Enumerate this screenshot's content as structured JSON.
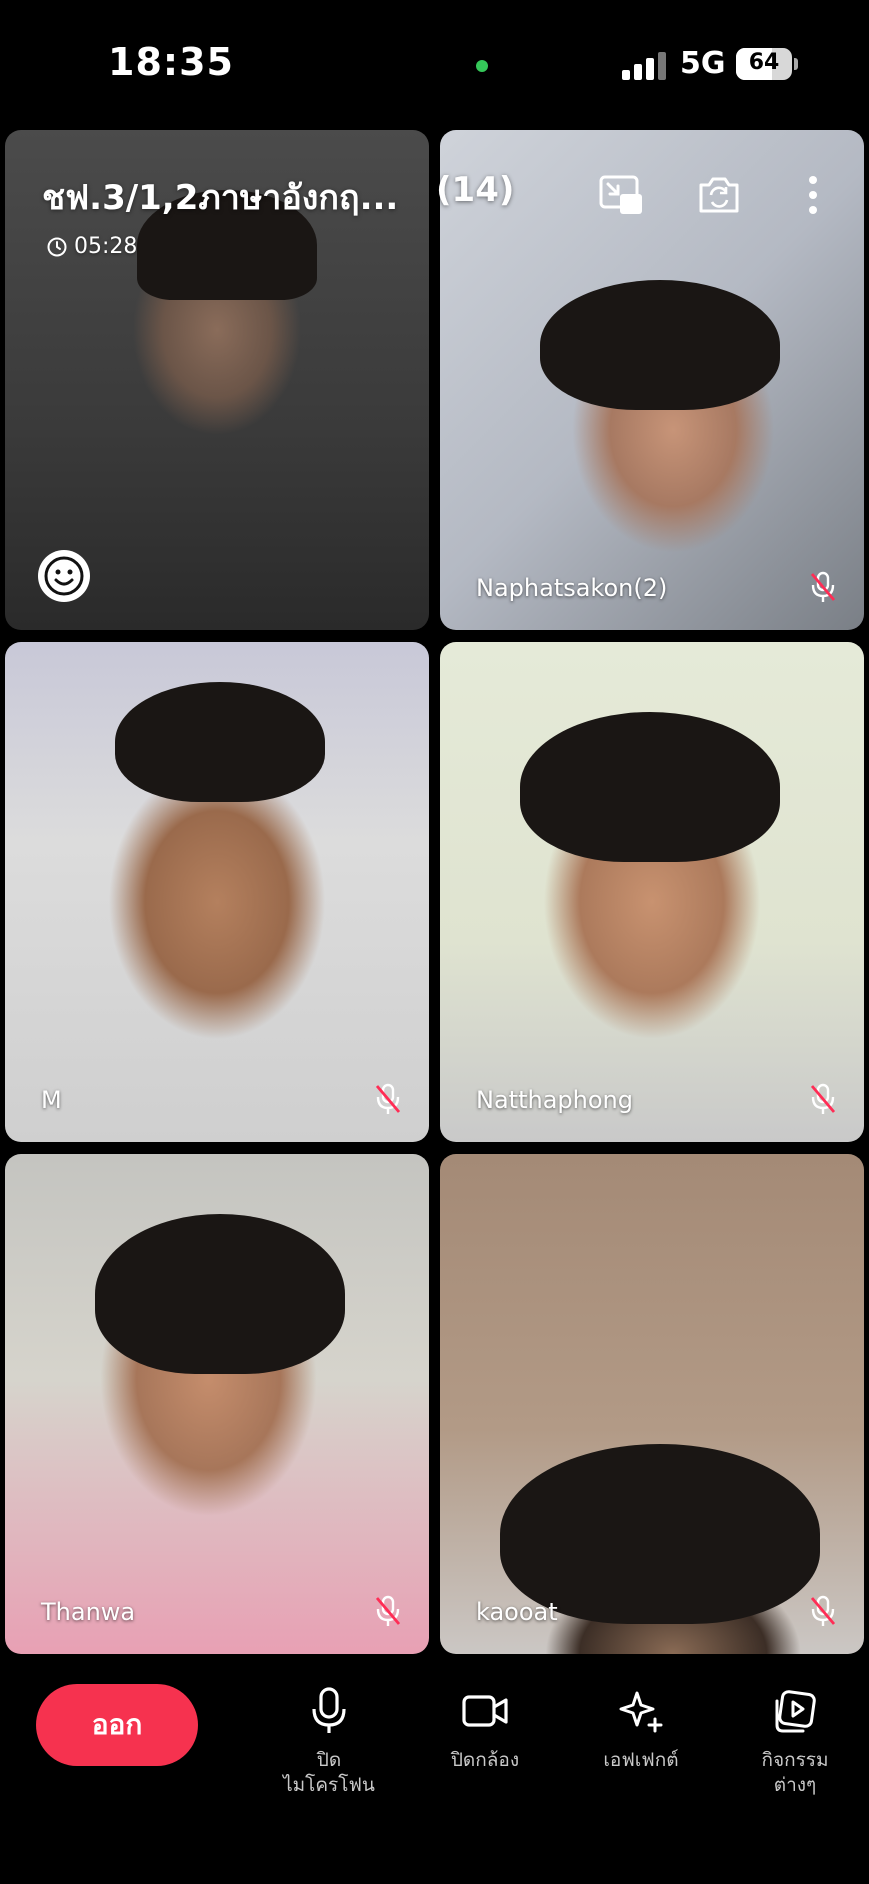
{
  "status_bar": {
    "time": "18:35",
    "network": "5G",
    "battery": "64",
    "battery_level": 0.64
  },
  "header": {
    "room_title": "ชฟ.3/1,2ภาษาอังกฤ...",
    "participant_count": "(14)",
    "elapsed": "05:28"
  },
  "participants": [
    {
      "name": "",
      "muted": false
    },
    {
      "name": "Naphatsakon(2)",
      "muted": true
    },
    {
      "name": "M",
      "muted": true
    },
    {
      "name": "Natthaphong",
      "muted": true
    },
    {
      "name": "Thanwa",
      "muted": true
    },
    {
      "name": "kaooat",
      "muted": true
    }
  ],
  "controls": {
    "leave": "ออก",
    "mic": [
      "ปิด",
      "ไมโครโฟน"
    ],
    "camera": "ปิดกล้อง",
    "effects": "เอฟเฟกต์",
    "activities": [
      "กิจกรรม",
      "ต่างๆ"
    ]
  },
  "colors": {
    "leave_button": "#f6324f",
    "mic_off": "#ff2d55",
    "camera_indicator": "#35c759"
  }
}
